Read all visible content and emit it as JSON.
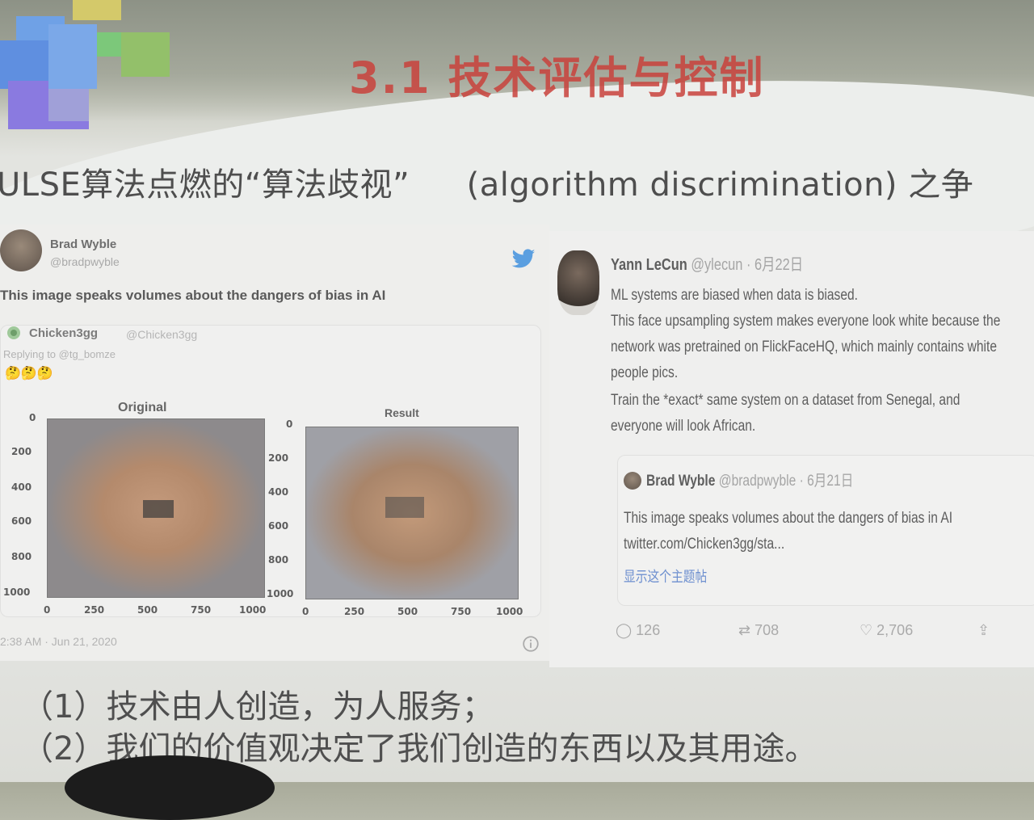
{
  "slide": {
    "title": "3.1 技术评估与控制",
    "subtitle_left": "ULSE算法点燃的“算法歧视”",
    "subtitle_right": "(algorithm discrimination) 之争",
    "point_1": "（1）技术由人创造，为人服务；",
    "point_2": "（2）我们的价值观决定了我们创造的东西以及其用途。"
  },
  "left_tweet": {
    "author": "Brad Wyble",
    "handle": "@bradpwyble",
    "text": "This image speaks volumes about the dangers of bias in AI",
    "timestamp": "2:38 AM · Jun 21, 2020",
    "quoted": {
      "author": "Chicken3gg",
      "handle": "@Chicken3gg",
      "replying": "Replying to @tg_bomze",
      "emoji": "🤔🤔🤔",
      "plot_left_title": "Original",
      "plot_right_title": "Result",
      "y_ticks": [
        "0",
        "200",
        "400",
        "600",
        "800",
        "1000"
      ],
      "x_ticks": [
        "0",
        "250",
        "500",
        "750",
        "1000"
      ]
    }
  },
  "right_tweet": {
    "author": "Yann LeCun",
    "handle": "@ylecun",
    "date": "· 6月22日",
    "line1": "ML systems are biased when data is biased.",
    "line2": "This face upsampling system makes everyone look white because the",
    "line3": "network was pretrained on FlickFaceHQ, which mainly contains white",
    "line4": "people pics.",
    "line5": "Train the *exact* same system on a dataset from Senegal, and",
    "line6": "everyone will look African.",
    "quoted": {
      "author": "Brad Wyble",
      "handle": "@bradpwyble",
      "date": "· 6月21日",
      "text": "This image speaks volumes about the dangers of bias in AI",
      "link": "twitter.com/Chicken3gg/sta...",
      "show_thread": "显示这个主题帖"
    },
    "replies": "126",
    "retweets": "708",
    "likes": "2,706"
  },
  "colors": {
    "title_red": "#c9423c",
    "twitter_blue": "#5b9fe0",
    "link_blue": "#6d8fcf"
  }
}
